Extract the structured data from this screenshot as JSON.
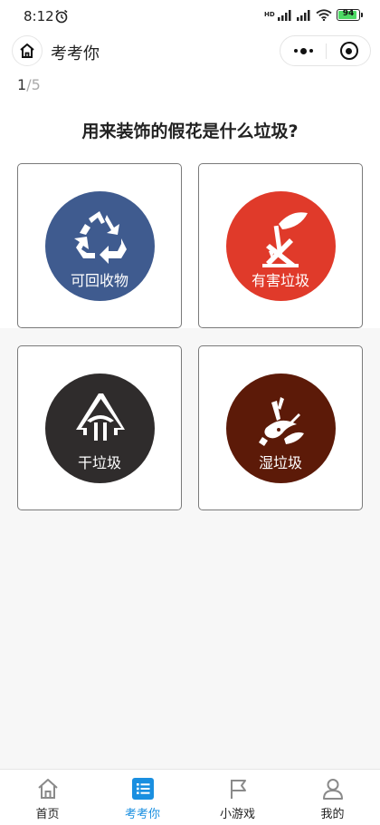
{
  "status_bar": {
    "time": "8:12",
    "network_label": "HD",
    "battery": "94",
    "battery_level": 0.94,
    "alarm_icon": "alarm-clock-icon",
    "signal_icon": "signal-icon",
    "wifi_icon": "wifi-icon"
  },
  "nav": {
    "title": "考考你",
    "home_icon": "home-icon",
    "more_icon": "more-dots-icon",
    "close_icon": "target-close-icon"
  },
  "progress": {
    "current": "1",
    "separator": "/",
    "total": "5"
  },
  "question": "用来装饰的假花是什么垃圾?",
  "options": [
    {
      "label": "可回收物",
      "icon": "recycle-icon",
      "color": "#3f5b8f"
    },
    {
      "label": "有害垃圾",
      "icon": "hazardous-waste-icon",
      "color": "#e03a2a"
    },
    {
      "label": "干垃圾",
      "icon": "dry-waste-icon",
      "color": "#2f2c2c"
    },
    {
      "label": "湿垃圾",
      "icon": "wet-waste-icon",
      "color": "#5c1a08"
    }
  ],
  "tabs": [
    {
      "label": "首页",
      "icon": "home-icon",
      "active": false
    },
    {
      "label": "考考你",
      "icon": "list-icon",
      "active": true
    },
    {
      "label": "小游戏",
      "icon": "flag-icon",
      "active": false
    },
    {
      "label": "我的",
      "icon": "user-icon",
      "active": false
    }
  ],
  "colors": {
    "accent": "#1a8fe0",
    "page_bg": "#f7f7f7",
    "card_border": "#7a7a7a"
  }
}
